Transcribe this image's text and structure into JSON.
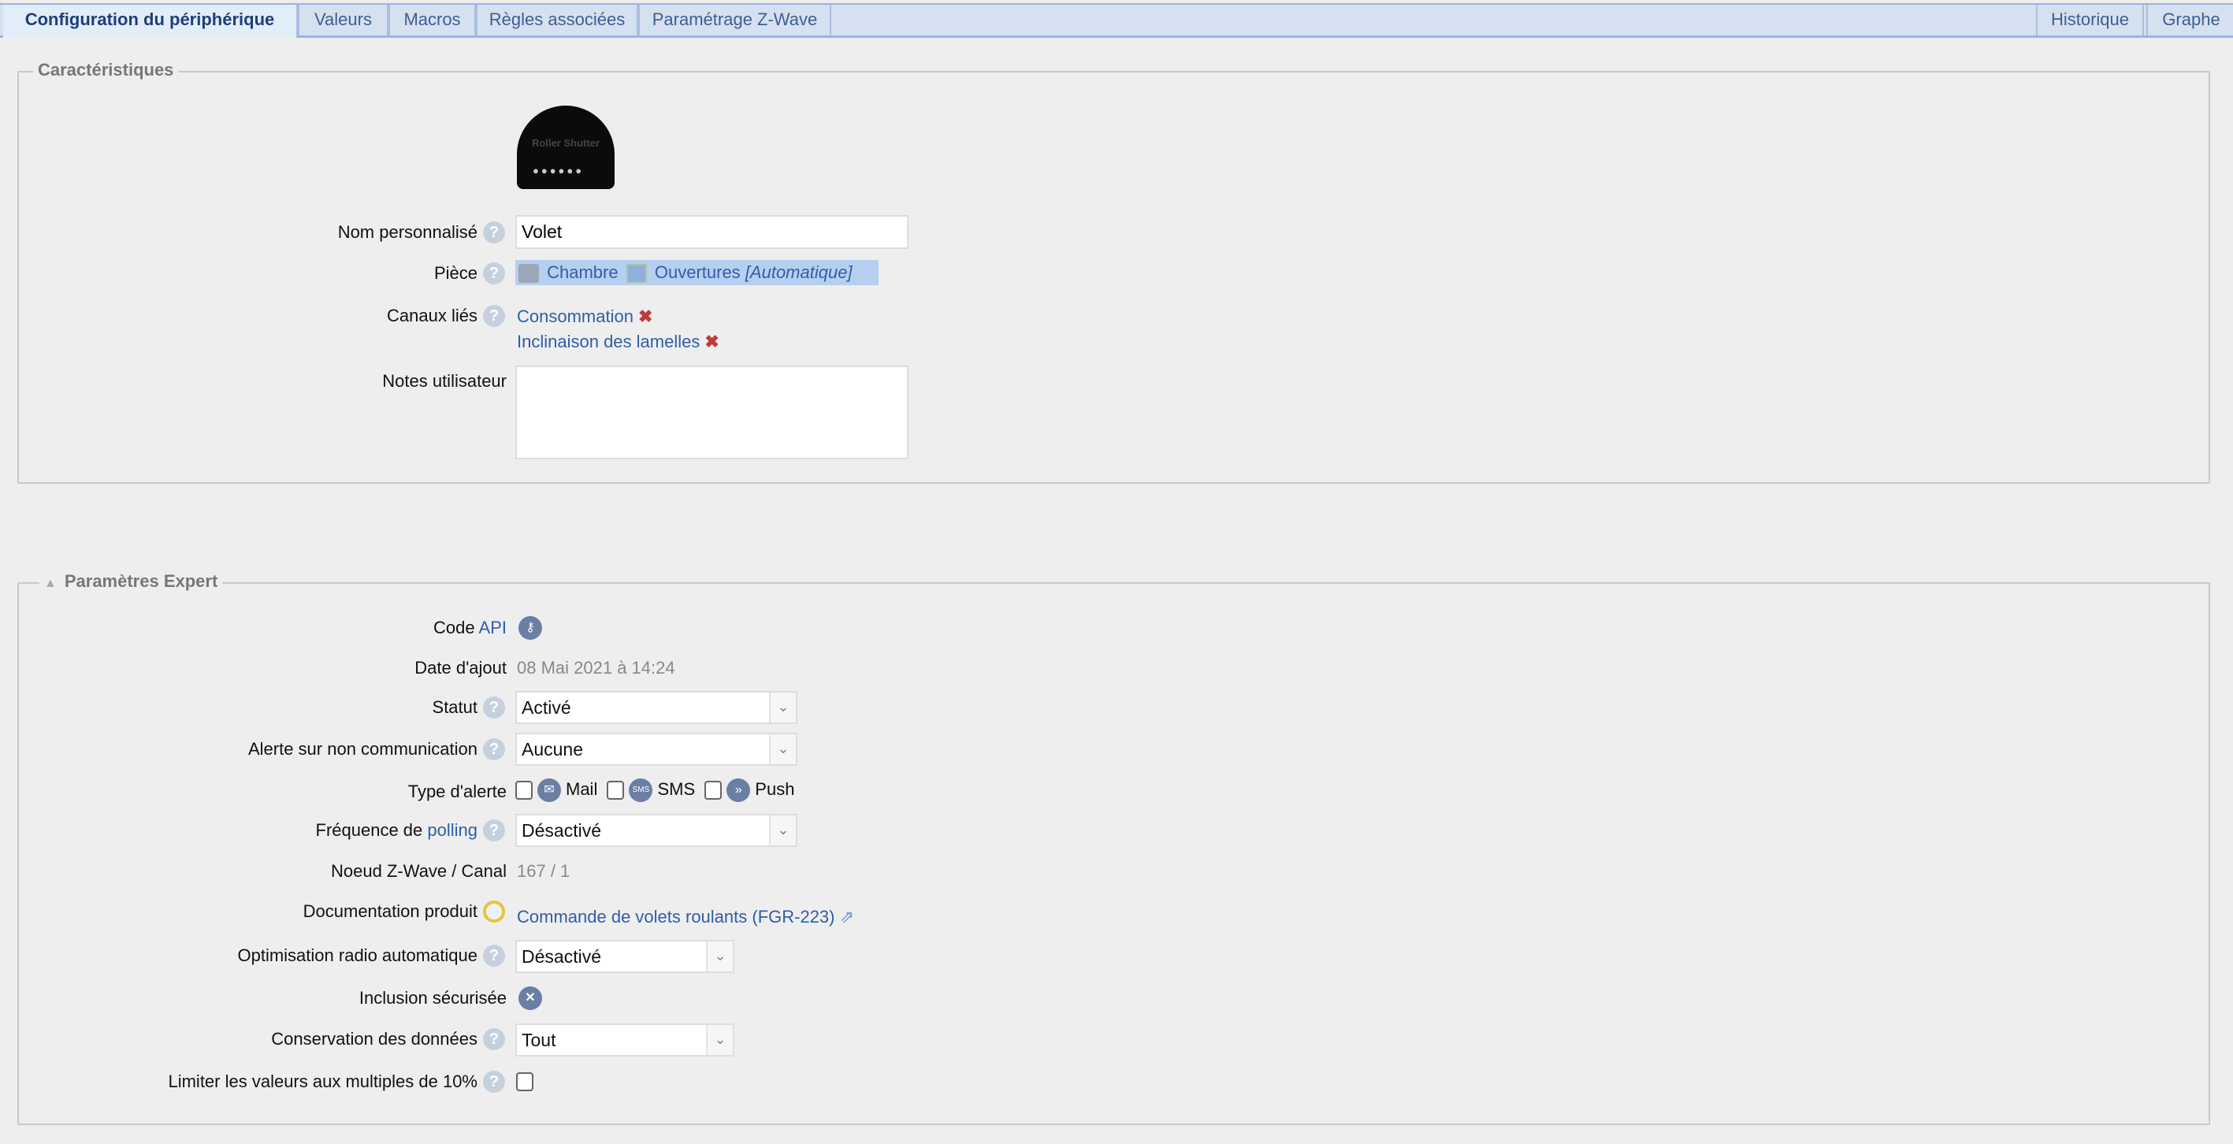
{
  "tabs": {
    "left": [
      "Configuration du périphérique",
      "Valeurs",
      "Macros",
      "Règles associées",
      "Paramétrage Z-Wave"
    ],
    "right": [
      "Historique",
      "Graphe"
    ],
    "active": 0
  },
  "caracteristiques": {
    "legend": "Caractéristiques",
    "device_image_text": "Roller Shutter",
    "nom": {
      "label": "Nom personnalisé",
      "value": "Volet"
    },
    "piece": {
      "label": "Pièce",
      "room": "Chambre",
      "category": "Ouvertures",
      "mode": "[Automatique]"
    },
    "canaux": {
      "label": "Canaux liés",
      "items": [
        "Consommation",
        "Inclinaison des lamelles"
      ]
    },
    "notes": {
      "label": "Notes utilisateur",
      "value": ""
    }
  },
  "expert": {
    "legend": "Paramètres Expert",
    "code": {
      "label": "Code",
      "link": "API"
    },
    "date": {
      "label": "Date d'ajout",
      "value": "08 Mai 2021 à 14:24"
    },
    "statut": {
      "label": "Statut",
      "value": "Activé"
    },
    "alerte": {
      "label": "Alerte sur non communication",
      "value": "Aucune"
    },
    "type": {
      "label": "Type d'alerte",
      "mail": "Mail",
      "sms": "SMS",
      "push": "Push",
      "sms_icon": "SMS"
    },
    "polling": {
      "label": "Fréquence de",
      "link": "polling",
      "value": "Désactivé"
    },
    "noeud": {
      "label": "Noeud Z-Wave / Canal",
      "value": "167 / 1"
    },
    "doc": {
      "label": "Documentation produit",
      "value": "Commande de volets roulants (FGR-223)"
    },
    "optim": {
      "label": "Optimisation radio automatique",
      "value": "Désactivé"
    },
    "inclusion": {
      "label": "Inclusion sécurisée"
    },
    "conservation": {
      "label": "Conservation des données",
      "value": "Tout"
    },
    "limiter": {
      "label": "Limiter les valeurs aux multiples de 10%"
    }
  },
  "colors": {
    "link": "#2f5ea8",
    "tab_bg": "#d5e0f0",
    "tab_border": "#9bb5de",
    "icon": "#6b7fa5",
    "background": "#eeeeee"
  }
}
